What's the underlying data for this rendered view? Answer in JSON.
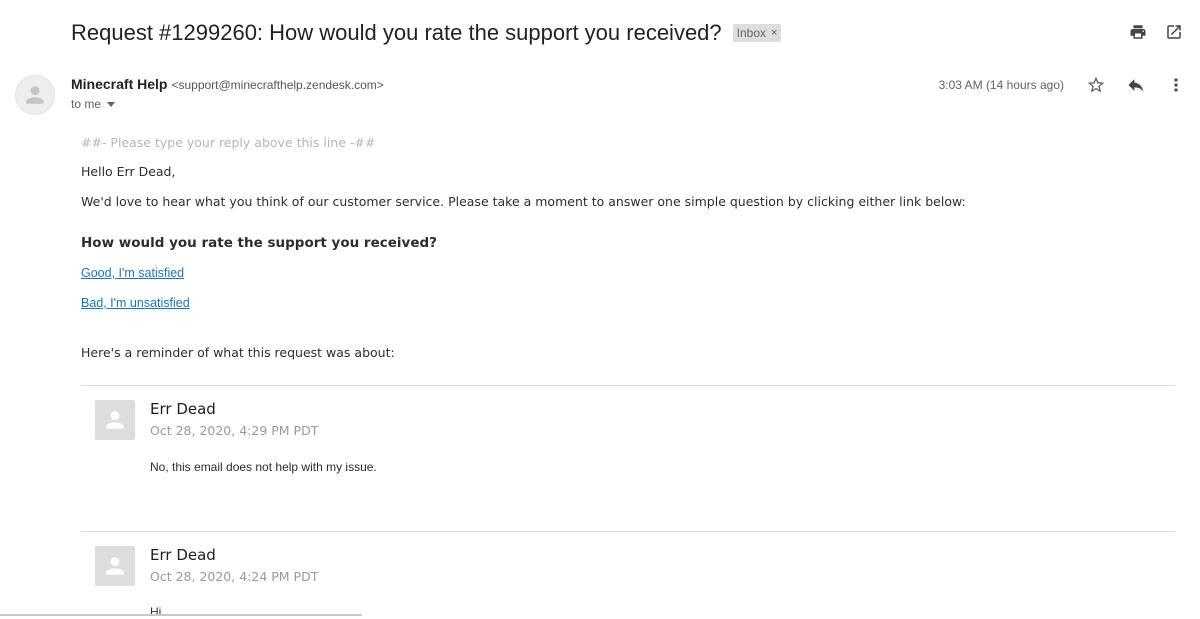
{
  "subject": "Request #1299260: How would you rate the support you received?",
  "label": {
    "text": "Inbox",
    "remove": "×"
  },
  "sender": {
    "name": "Minecraft Help",
    "email": "<support@minecrafthelp.zendesk.com>",
    "to": "to me",
    "time": "3:03 AM (14 hours ago)"
  },
  "icons": {
    "print": "print-icon",
    "open_new_window": "open-in-new-window-icon",
    "star": "star-icon",
    "reply": "reply-icon",
    "more": "more-vertical-icon",
    "avatar": "person-icon"
  },
  "body": {
    "reply_line": "##- Please type your reply above this line -##",
    "greeting": "Hello Err Dead,",
    "intro": "We'd love to hear what you think of our customer service. Please take a moment to answer one simple question by clicking either link below:",
    "question": "How would you rate the support you received?",
    "good_link": "Good, I'm satisfied",
    "bad_link": "Bad, I'm unsatisfied",
    "reminder": "Here's a reminder of what this request was about:"
  },
  "comments": [
    {
      "author": "Err Dead",
      "date": "Oct 28, 2020, 4:29 PM PDT",
      "text": "No, this email does not help with my issue."
    },
    {
      "author": "Err Dead",
      "date": "Oct 28, 2020, 4:24 PM PDT",
      "text": "Hi"
    }
  ],
  "colors": {
    "link": "#1f73b7",
    "muted": "#999999",
    "label_bg": "#dddddd"
  }
}
